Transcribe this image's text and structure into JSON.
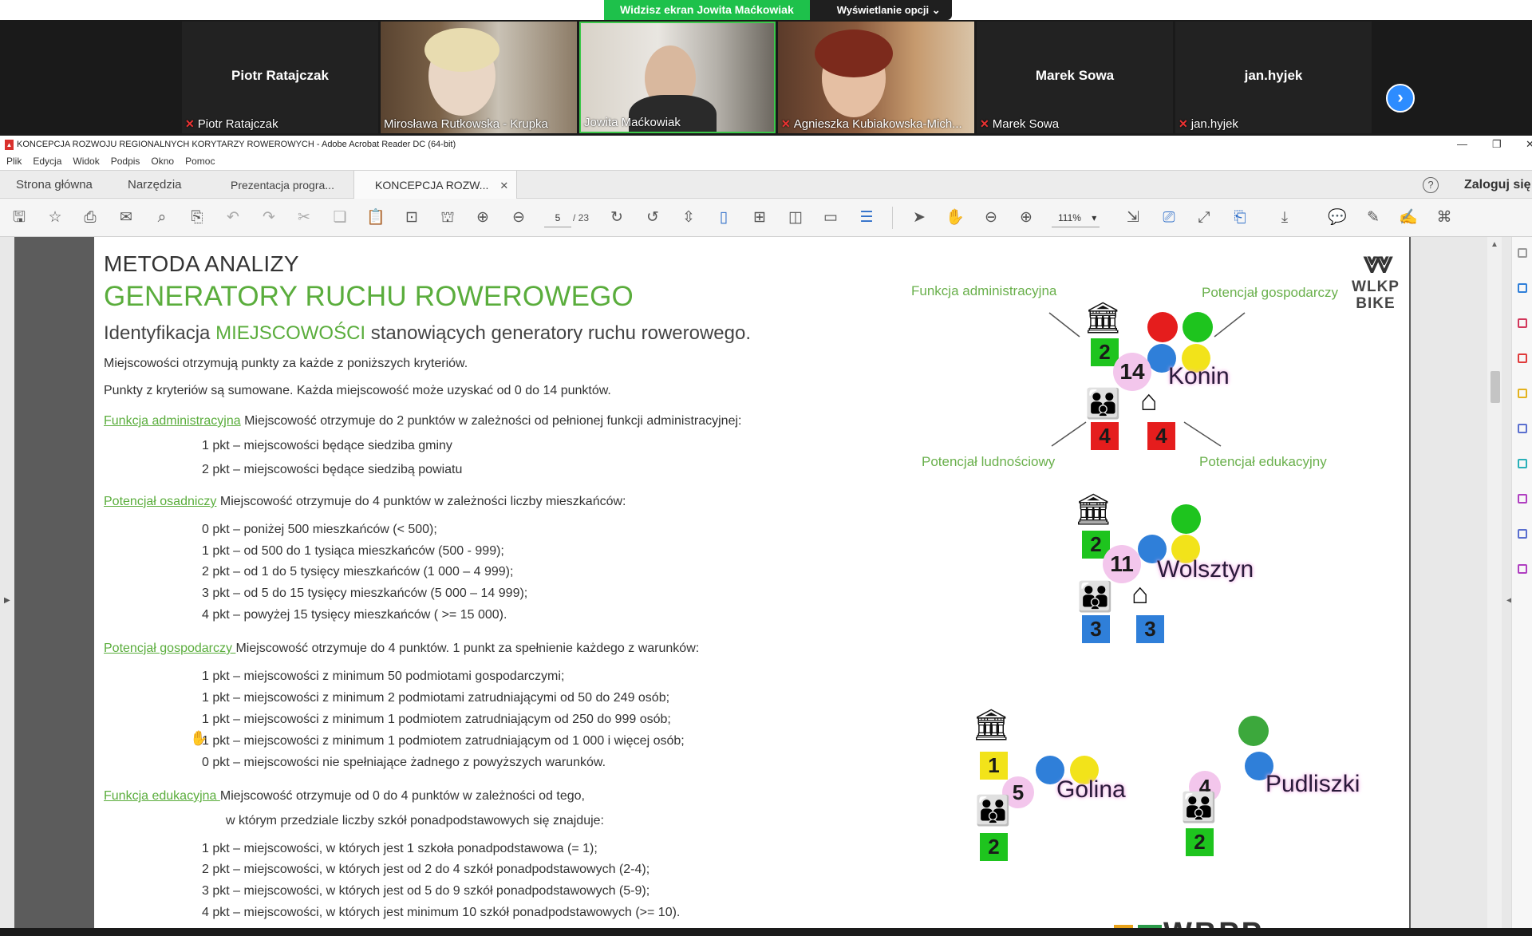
{
  "zoom": {
    "share_notice": "Widzisz ekran Jowita Maćkowiak",
    "view_options": "Wyświetlanie opcji",
    "participants": [
      {
        "name": "Piotr Ratajczak",
        "label": "Piotr Ratajczak"
      },
      {
        "name": "",
        "label": "Mirosława Rutkowska - Krupka"
      },
      {
        "name": "",
        "label": "Jowita Maćkowiak"
      },
      {
        "name": "",
        "label": "Agnieszka Kubiakowska-Mich..."
      },
      {
        "name": "Marek Sowa",
        "label": "Marek Sowa"
      },
      {
        "name": "jan.hyjek",
        "label": "jan.hyjek"
      }
    ]
  },
  "acrobat": {
    "window_title": "KONCEPCJA ROZWOJU REGIONALNYCH KORYTARZY ROWEROWYCH - Adobe Acrobat Reader DC (64-bit)",
    "menu": [
      "Plik",
      "Edycja",
      "Widok",
      "Podpis",
      "Okno",
      "Pomoc"
    ],
    "tabs": [
      "Strona główna",
      "Narzędzia",
      "Prezentacja progra...",
      "KONCEPCJA ROZW..."
    ],
    "login": "Zaloguj się",
    "page_current": "5",
    "page_total": "/ 23",
    "zoom": "111%"
  },
  "page": {
    "h1": "METODA ANALIZY",
    "h2": "GENERATORY RUCHU ROWEROWEGO",
    "h3_pre": "Identyfikacja ",
    "h3_acc": "MIEJSCOWOŚCI",
    "h3_post": " stanowiących generatory ruchu rowerowego.",
    "intro1": "Miejscowości otrzymują punkty za każde z poniższych kryteriów.",
    "intro2": "Punkty z kryteriów są sumowane. Każda miejscowość może uzyskać od 0 do 14 punktów.",
    "s1_link": "Funkcja administracyjna",
    "s1_text": " Miejscowość otrzymuje do 2 punktów w zależności od pełnionej funkcji administracyjnej:",
    "s1_items": [
      "1 pkt – miejscowości będące siedziba gminy",
      "2 pkt – miejscowości będące siedzibą powiatu"
    ],
    "s2_link": "Potencjał osadniczy",
    "s2_text": " Miejscowość otrzymuje do 4 punktów w zależności liczby mieszkańców:",
    "s2_items": [
      "0 pkt – poniżej 500 mieszkańców (< 500);",
      "1 pkt – od 500 do 1 tysiąca mieszkańców (500 - 999);",
      "2 pkt – od 1 do 5 tysięcy mieszkańców (1 000 – 4 999);",
      "3 pkt – od 5 do 15 tysięcy mieszkańców (5 000 – 14 999);",
      "4 pkt – powyżej 15 tysięcy mieszkańców ( >= 15 000)."
    ],
    "s3_link": "Potencjał gospodarczy ",
    "s3_text": "Miejscowość otrzymuje do 4 punktów. 1 punkt za spełnienie każdego z warunków:",
    "s3_items": [
      "1 pkt – miejscowości z minimum 50 podmiotami gospodarczymi;",
      "1 pkt – miejscowości z minimum 2 podmiotami zatrudniającymi od 50 do 249 osób;",
      "1 pkt – miejscowości z minimum 1 podmiotem zatrudniającym od 250 do 999 osób;",
      "1 pkt – miejscowości z minimum 1 podmiotem zatrudniającym od 1 000 i więcej osób;",
      "0 pkt – miejscowości nie spełniające żadnego z powyższych warunków."
    ],
    "s4_link": "Funkcja edukacyjna ",
    "s4_text": "Miejscowość otrzymuje od 0 do 4 punktów w zależności od tego,",
    "s4_text2": "w którym przedziale liczby szkół ponadpodstawowych się znajduje:",
    "s4_items": [
      "1 pkt – miejscowości, w których jest 1 szkoła ponadpodstawowa (= 1);",
      "2 pkt – miejscowości, w których jest od 2 do 4 szkół ponadpodstawowych (2-4);",
      "3 pkt – miejscowości, w których jest od 5 do 9 szkół ponadpodstawowych (5-9);",
      "4 pkt – miejscowości, w których jest minimum 10 szkół ponadpodstawowych (>= 10)."
    ]
  },
  "diagram": {
    "labels": {
      "admin": "Funkcja administracyjna",
      "econ": "Potencjał gospodarczy",
      "pop": "Potencjał ludnościowy",
      "edu": "Potencjał edukacyjny"
    },
    "cities": [
      {
        "name": "Konin",
        "score": "14",
        "admin": "2",
        "pop": "4",
        "edu": "4"
      },
      {
        "name": "Wolsztyn",
        "score": "11",
        "admin": "2",
        "pop": "3",
        "edu": "3"
      },
      {
        "name": "Golina",
        "score": "5",
        "admin": "1",
        "pop": "2"
      },
      {
        "name": "Pudliszki",
        "score": "4",
        "pop": "2"
      }
    ],
    "logo": "WLKP BIKE",
    "footer_logo": "WBPP",
    "colors": {
      "green": "#1ec41e",
      "red": "#e51d1d",
      "blue": "#2f7fd9",
      "yellow": "#f2e31a",
      "pink": "#f3c6ec",
      "label_green": "#6ab04c"
    }
  }
}
